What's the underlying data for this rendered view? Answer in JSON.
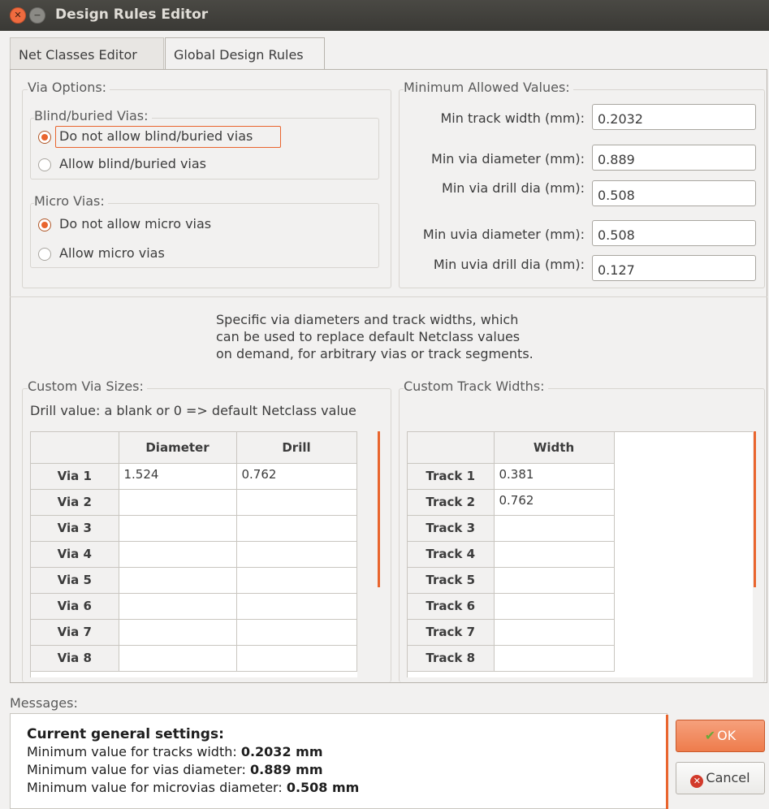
{
  "window": {
    "title": "Design Rules Editor"
  },
  "tabs": [
    {
      "label": "Net Classes Editor"
    },
    {
      "label": "Global Design Rules"
    }
  ],
  "via_options": {
    "title": "Via Options:",
    "blind_buried": {
      "title": "Blind/buried Vias:",
      "options": [
        "Do not allow blind/buried vias",
        "Allow blind/buried vias"
      ],
      "selected": "Do not allow blind/buried vias"
    },
    "micro": {
      "title": "Micro Vias:",
      "options": [
        "Do not allow micro vias",
        "Allow micro vias"
      ],
      "selected": "Do not allow micro vias"
    }
  },
  "min_values": {
    "title": "Minimum Allowed Values:",
    "fields": [
      {
        "label": "Min track width (mm):",
        "value": "0.2032"
      },
      {
        "label": "Min via diameter (mm):",
        "value": "0.889"
      },
      {
        "label": "Min via drill dia (mm):",
        "value": "0.508"
      },
      {
        "label": "Min uvia diameter (mm):",
        "value": "0.508"
      },
      {
        "label": "Min uvia drill dia (mm):",
        "value": "0.127"
      }
    ]
  },
  "description": [
    "Specific via diameters and track widths, which",
    "can be used to replace default Netclass values",
    "on demand, for arbitrary vias or track segments."
  ],
  "custom_vias": {
    "title": "Custom Via Sizes:",
    "note": "Drill value: a blank or 0 => default Netclass value",
    "columns": [
      "Diameter",
      "Drill"
    ],
    "rows": [
      {
        "label": "Via 1",
        "diameter": "1.524",
        "drill": "0.762"
      },
      {
        "label": "Via 2",
        "diameter": "",
        "drill": ""
      },
      {
        "label": "Via 3",
        "diameter": "",
        "drill": ""
      },
      {
        "label": "Via 4",
        "diameter": "",
        "drill": ""
      },
      {
        "label": "Via 5",
        "diameter": "",
        "drill": ""
      },
      {
        "label": "Via 6",
        "diameter": "",
        "drill": ""
      },
      {
        "label": "Via 7",
        "diameter": "",
        "drill": ""
      },
      {
        "label": "Via 8",
        "diameter": "",
        "drill": ""
      }
    ]
  },
  "custom_tracks": {
    "title": "Custom Track Widths:",
    "columns": [
      "Width"
    ],
    "rows": [
      {
        "label": "Track 1",
        "width": "0.381"
      },
      {
        "label": "Track 2",
        "width": "0.762"
      },
      {
        "label": "Track 3",
        "width": ""
      },
      {
        "label": "Track 4",
        "width": ""
      },
      {
        "label": "Track 5",
        "width": ""
      },
      {
        "label": "Track 6",
        "width": ""
      },
      {
        "label": "Track 7",
        "width": ""
      },
      {
        "label": "Track 8",
        "width": ""
      }
    ]
  },
  "messages": {
    "label": "Messages:",
    "header": "Current general settings:",
    "lines": [
      {
        "text": "Minimum value for tracks width: ",
        "value": "0.2032 mm"
      },
      {
        "text": "Minimum value for vias diameter: ",
        "value": "0.889 mm"
      },
      {
        "text": "Minimum value for microvias diameter: ",
        "value": "0.508 mm"
      }
    ]
  },
  "buttons": {
    "ok": "OK",
    "cancel": "Cancel"
  },
  "icons": {
    "ok": "checkmark-icon",
    "cancel": "cancel-circle-icon",
    "close": "close-window-icon"
  },
  "colors": {
    "accent": "#e9652e",
    "titlebar": "#3f3e3a"
  }
}
